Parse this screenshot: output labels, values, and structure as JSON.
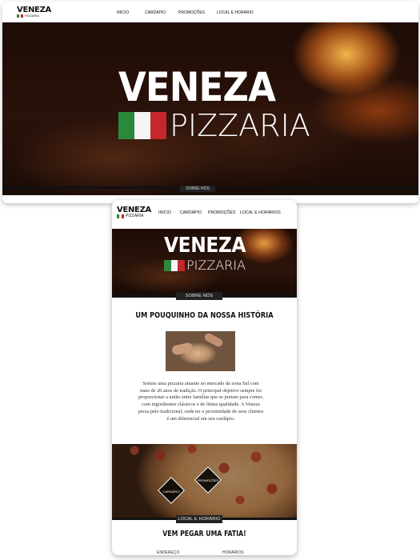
{
  "brand": {
    "name": "VENEZA",
    "sub": "PIZZARIA",
    "flag_colors": [
      "#2a8a3c",
      "#f4f4f4",
      "#c8262d"
    ]
  },
  "desktop": {
    "nav": [
      "INICIO",
      "CARDÁPIO",
      "PROMOÇÕES",
      "LOCAL E HORÁRIO"
    ],
    "hero_tab": "SOBRE NÓS"
  },
  "mobile": {
    "nav": [
      "INICIO",
      "CARDÁPIO",
      "PROMOÇÕES",
      "LOCAL E HORÁRIOS"
    ],
    "section_about_tab": "SOBRE NÓS",
    "about_title": "UM POUQUINHO DA NOSSA HISTÓRIA",
    "about_text": "Somos uma pizzaria atuante no mercado da zona Sul com mais de 20 anos de tradição. O principal objetivo sempre foi proporcionar a união entre famílias que se juntam para comer, com ingredientes clássicos e de ótima qualidade. A Veneza preza pelo tradicional, onde ter a proximidade de seus clientes é um diferencial em seu cardápio.",
    "diamond_buttons": [
      "CARDÁPIO",
      "PROMOÇÕES"
    ],
    "location_tab": "LOCAL E HORÁRIO",
    "location_title": "VEM PEGAR UMA FATIA!",
    "bottom_labels": [
      "ENDEREÇO",
      "HORÁRIOS"
    ]
  },
  "colors": {
    "dark_bar": "#111111",
    "tab_bg": "#222222"
  }
}
